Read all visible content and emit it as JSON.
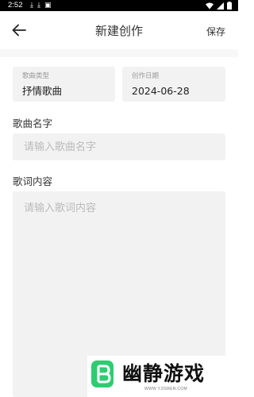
{
  "status_bar": {
    "time": "2:52",
    "left_icons": [
      "download-icon",
      "download-icon",
      "notification-icon"
    ],
    "right_icons": [
      "wifi-icon",
      "signal-icon",
      "battery-icon"
    ]
  },
  "app_bar": {
    "back_icon": "arrow-left-icon",
    "title": "新建创作",
    "save_label": "保存"
  },
  "genre_card": {
    "label": "歌曲类型",
    "value": "抒情歌曲"
  },
  "date_card": {
    "label": "创作日期",
    "value": "2024-06-28"
  },
  "song_name": {
    "label": "歌曲名字",
    "placeholder": "请输入歌曲名字",
    "value": ""
  },
  "lyrics": {
    "label": "歌词内容",
    "placeholder": "请输入歌词内容",
    "value": ""
  },
  "watermark": {
    "text": "幽静游戏",
    "url": "WWW.YJISREN.COM"
  },
  "colors": {
    "card_background": "#f2f2f2",
    "placeholder": "#bbbbbb",
    "watermark_accent": "#2ecc71"
  }
}
